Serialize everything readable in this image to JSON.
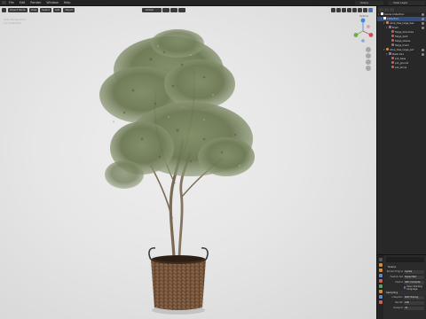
{
  "topbar": {
    "menu": [
      "File",
      "Edit",
      "Render",
      "Window",
      "Help"
    ],
    "scene": "Scene",
    "view_layer": "View Layer"
  },
  "viewport": {
    "header": {
      "mode": "Object Mode",
      "menus": [
        "View",
        "Select",
        "Add",
        "Object"
      ],
      "transform": "Global"
    },
    "view_label": [
      "User Perspective",
      "(1) Collection"
    ],
    "options_label": "Options"
  },
  "outliner": {
    "rows": [
      {
        "label": "Scene Collection",
        "kind": "col",
        "indent": 0,
        "selected": false
      },
      {
        "label": "Collection",
        "kind": "col",
        "indent": 1,
        "selected": true
      },
      {
        "label": "olive_tree_large_bas",
        "kind": "obj",
        "indent": 2,
        "selected": false
      },
      {
        "label": "Bush",
        "kind": "mesh",
        "indent": 3,
        "selected": false
      },
      {
        "label": "Twigs_branches",
        "kind": "mat",
        "indent": 4,
        "selected": false
      },
      {
        "label": "Twigs_bark",
        "kind": "mat",
        "indent": 4,
        "selected": false
      },
      {
        "label": "Twigs_leaves",
        "kind": "mat",
        "indent": 4,
        "selected": false
      },
      {
        "label": "Twigs_trunk",
        "kind": "mat",
        "indent": 4,
        "selected": false
      },
      {
        "label": "olive_tree_large_pot",
        "kind": "obj",
        "indent": 2,
        "selected": false
      },
      {
        "label": "Mesh.011",
        "kind": "mesh",
        "indent": 3,
        "selected": false
      },
      {
        "label": "pot_base",
        "kind": "mat",
        "indent": 4,
        "selected": false
      },
      {
        "label": "pot_ground",
        "kind": "mat",
        "indent": 4,
        "selected": false
      },
      {
        "label": "pot_stone",
        "kind": "mat",
        "indent": 4,
        "selected": false
      }
    ]
  },
  "properties": {
    "title": "Scene",
    "rows": [
      {
        "label": "Render Engine",
        "value": "Cycles"
      },
      {
        "label": "Feature Set",
        "value": "Supported"
      },
      {
        "label": "Device",
        "value": "GPU Compute"
      }
    ],
    "check": "Open Shading Language",
    "section": "Sampling",
    "rows2": [
      {
        "label": "Integrator",
        "value": "Path Tracing"
      },
      {
        "label": "Render",
        "value": "128"
      },
      {
        "label": "Viewport",
        "value": "32"
      }
    ]
  },
  "colors": {
    "accent": "#4772b3",
    "selection": "#334d80",
    "background": "#e8e8e8"
  }
}
